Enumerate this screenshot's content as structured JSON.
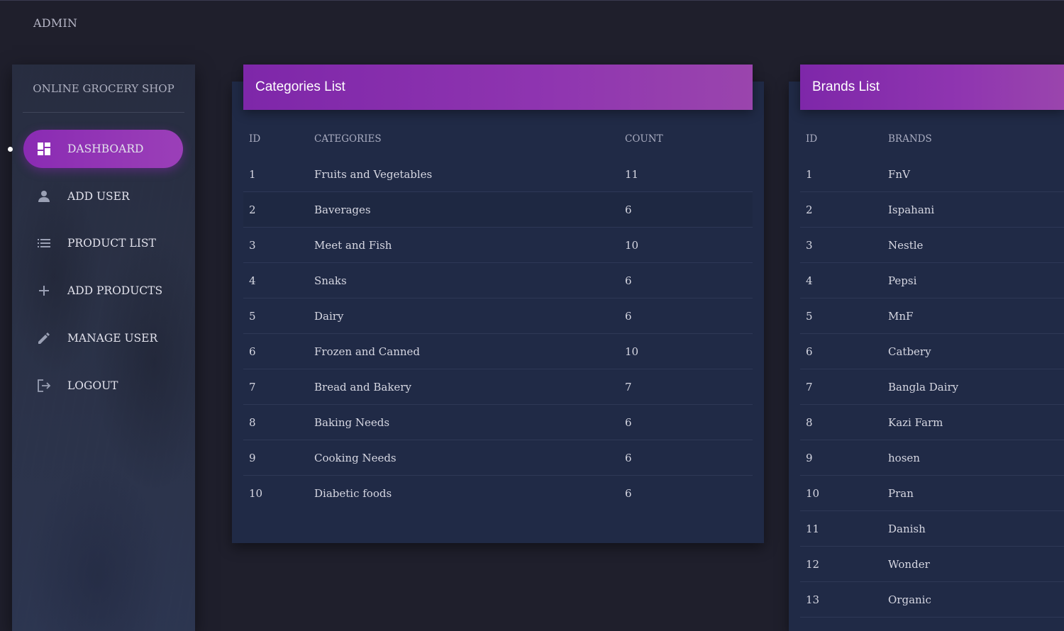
{
  "header": {
    "brand": "ADMIN"
  },
  "sidebar": {
    "title": "ONLINE GROCERY SHOP",
    "items": [
      {
        "label": "DASHBOARD",
        "icon": "dashboard-icon",
        "active": true
      },
      {
        "label": "ADD USER",
        "icon": "person-icon",
        "active": false
      },
      {
        "label": "PRODUCT LIST",
        "icon": "list-icon",
        "active": false
      },
      {
        "label": "ADD PRODUCTS",
        "icon": "plus-icon",
        "active": false
      },
      {
        "label": "MANAGE USER",
        "icon": "pencil-icon",
        "active": false
      },
      {
        "label": "LOGOUT",
        "icon": "logout-icon",
        "active": false
      }
    ]
  },
  "categories": {
    "title": "Categories List",
    "columns": [
      "ID",
      "CATEGORIES",
      "COUNT"
    ],
    "rows": [
      [
        "1",
        "Fruits and Vegetables",
        "11"
      ],
      [
        "2",
        "Baverages",
        "6"
      ],
      [
        "3",
        "Meet and Fish",
        "10"
      ],
      [
        "4",
        "Snaks",
        "6"
      ],
      [
        "5",
        "Dairy",
        "6"
      ],
      [
        "6",
        "Frozen and Canned",
        "10"
      ],
      [
        "7",
        "Bread and Bakery",
        "7"
      ],
      [
        "8",
        "Baking Needs",
        "6"
      ],
      [
        "9",
        "Cooking Needs",
        "6"
      ],
      [
        "10",
        "Diabetic foods",
        "6"
      ]
    ]
  },
  "brands": {
    "title": "Brands List",
    "columns": [
      "ID",
      "BRANDS"
    ],
    "rows": [
      [
        "1",
        "FnV"
      ],
      [
        "2",
        "Ispahani"
      ],
      [
        "3",
        "Nestle"
      ],
      [
        "4",
        "Pepsi"
      ],
      [
        "5",
        "MnF"
      ],
      [
        "6",
        "Catbery"
      ],
      [
        "7",
        "Bangla Dairy"
      ],
      [
        "8",
        "Kazi Farm"
      ],
      [
        "9",
        "hosen"
      ],
      [
        "10",
        "Pran"
      ],
      [
        "11",
        "Danish"
      ],
      [
        "12",
        "Wonder"
      ],
      [
        "13",
        "Organic"
      ]
    ]
  },
  "colors": {
    "accent": "#8a2bb3",
    "card": "#202a46",
    "background": "#1f1f2c"
  }
}
